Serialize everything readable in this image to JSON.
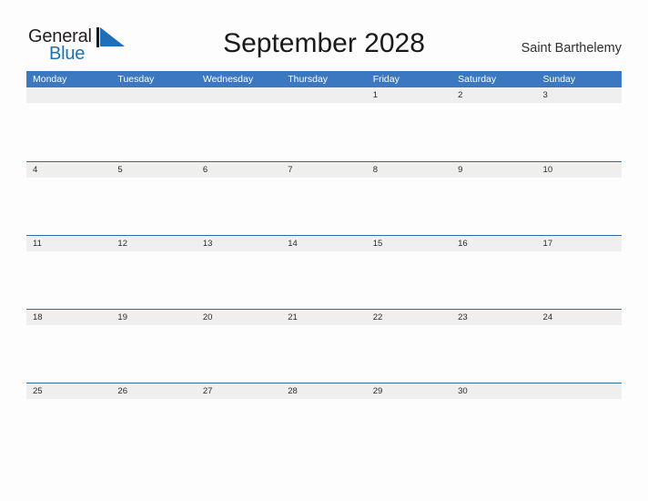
{
  "brand": {
    "name_part1": "General",
    "name_part2": "Blue",
    "flag_icon": "blue-triangle-flag-icon",
    "color_dark": "#231f20",
    "color_blue": "#1f6fb8"
  },
  "header": {
    "title": "September 2028",
    "region": "Saint Barthelemy"
  },
  "theme": {
    "header_blue": "#3c78bf",
    "row_line_blue": "#2e6da4",
    "band_gray": "#efefef",
    "page_background": "#fdfdfd"
  },
  "calendar": {
    "month": "September",
    "year": "2028",
    "weekday_headers": [
      "Monday",
      "Tuesday",
      "Wednesday",
      "Thursday",
      "Friday",
      "Saturday",
      "Sunday"
    ],
    "weeks": [
      {
        "days": [
          "",
          "",
          "",
          "",
          "1",
          "2",
          "3"
        ]
      },
      {
        "days": [
          "4",
          "5",
          "6",
          "7",
          "8",
          "9",
          "10"
        ]
      },
      {
        "days": [
          "11",
          "12",
          "13",
          "14",
          "15",
          "16",
          "17"
        ]
      },
      {
        "days": [
          "18",
          "19",
          "20",
          "21",
          "22",
          "23",
          "24"
        ]
      },
      {
        "days": [
          "25",
          "26",
          "27",
          "28",
          "29",
          "30",
          ""
        ]
      }
    ]
  }
}
